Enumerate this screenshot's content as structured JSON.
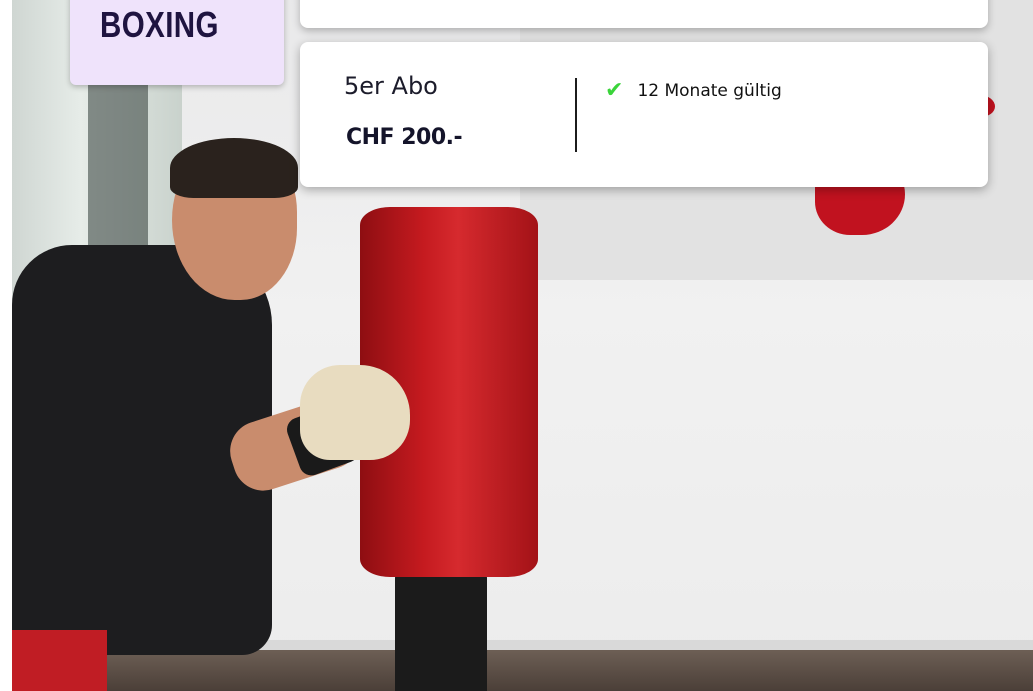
{
  "hero": {
    "title": "BOXING"
  },
  "pricing": {
    "plan_name": "5er Abo",
    "price": "CHF 200.-",
    "features": [
      {
        "icon": "check-icon",
        "label": "12 Monate gültig"
      }
    ]
  },
  "colors": {
    "title_card_bg": "#efe3fb",
    "title_text": "#1f1440",
    "check": "#3ad43a",
    "bag_red": "#c41a1f"
  }
}
